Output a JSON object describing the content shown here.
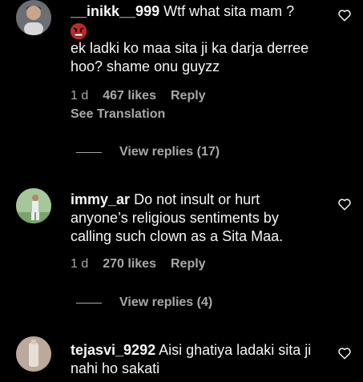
{
  "comments": [
    {
      "username": "__inikk__999",
      "text": "Wtf what sita mam ?",
      "text2": "ek ladki ko maa sita ji ka darja derree hoo? shame onu guyzz",
      "time": "1 d",
      "likes": "467 likes",
      "reply": "Reply",
      "see_translation": "See Translation",
      "view_replies": "View replies (17)"
    },
    {
      "username": "immy_ar",
      "text": "Do not insult or hurt anyone’s religious sentiments by calling such clown as a Sita Maa.",
      "time": "1 d",
      "likes": "270 likes",
      "reply": "Reply",
      "view_replies": "View replies (4)"
    },
    {
      "username": "tejasvi_9292",
      "text": "Aisi ghatiya ladaki sita ji nahi ho sakati"
    }
  ],
  "icons": {
    "heart": "heart-icon",
    "emoji": "enraged-face-emoji"
  },
  "colors": {
    "background": "#000000",
    "primary_text": "#f5f5f5",
    "secondary_text": "#a8a8a8"
  }
}
